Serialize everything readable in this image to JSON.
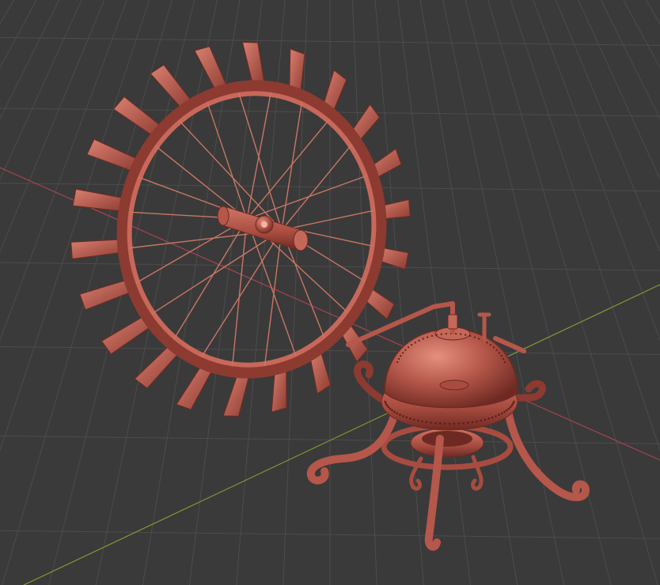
{
  "viewport": {
    "background_color": "#3a3a3a",
    "grid_color": "#4c4c4c",
    "x_axis_color": "#a8434f",
    "y_axis_color": "#7c9a35",
    "show_grid": true,
    "show_axes": true
  },
  "scene": {
    "objects": [
      {
        "name": "paddle-wheel",
        "icon": "paddle-wheel",
        "spokes": 24,
        "paddles": 22
      },
      {
        "name": "boiler",
        "icon": "spherical-boiler",
        "legs": 3
      }
    ],
    "material": {
      "base_color": "#b5574a",
      "shadow_color": "#6e2a22",
      "highlight_color": "#e5907f"
    }
  }
}
